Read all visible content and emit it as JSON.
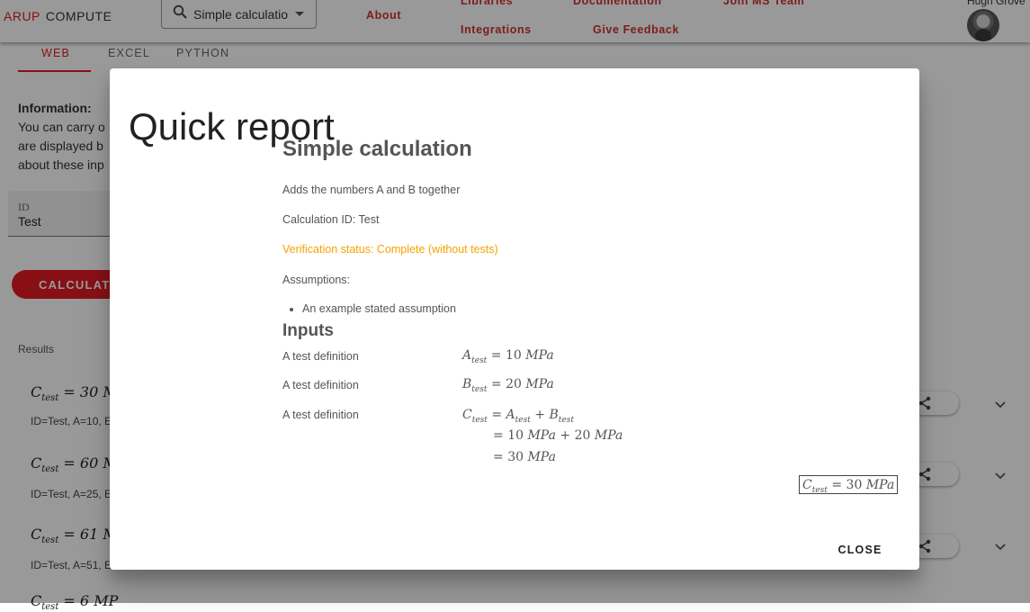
{
  "header": {
    "brand_arup": "ARUP",
    "brand_compute": "COMPUTE",
    "calc_select_value": "Simple calculation",
    "nav": {
      "about": "About",
      "libraries": "Libraries",
      "documentation": "Documentation",
      "join_team": "Join MS Team",
      "integrations": "Integrations",
      "feedback": "Give Feedback"
    },
    "user_name": "Hugh Grove"
  },
  "tabs": {
    "web": "WEB",
    "excel": "EXCEL",
    "python": "PYTHON"
  },
  "info": {
    "heading": "Information:",
    "line1": "You can carry o",
    "line2": "are displayed b",
    "line3": "about these inp"
  },
  "id_field": {
    "label": "ID",
    "value": "Test"
  },
  "calculate_label": "CALCULATE",
  "results_label": "Results",
  "results": [
    {
      "value": "30 M",
      "sub": "ID=Test, A=10, E"
    },
    {
      "value": "60 M",
      "sub": "ID=Test, A=25, E"
    },
    {
      "value": "61 M",
      "sub": "ID=Test, A=51, E"
    },
    {
      "value": "6 MP"
    }
  ],
  "dialog": {
    "title": "Quick report",
    "calc_title": "Simple calculation",
    "description": "Adds the numbers A and B together",
    "calc_id": "Calculation ID: Test",
    "verification": "Verification status: Complete (without tests)",
    "assumptions_label": "Assumptions:",
    "assumptions": [
      "An example stated assumption"
    ],
    "inputs_heading": "Inputs",
    "inputs": [
      {
        "definition": "A test definition"
      },
      {
        "definition": "A test definition"
      },
      {
        "definition": "A test definition"
      }
    ],
    "a_value": "10",
    "b_value": "20",
    "c_value": "30",
    "unit": "MPa",
    "close_label": "CLOSE"
  },
  "colors": {
    "brand_red": "#e31b23",
    "status_orange": "#f5a300"
  }
}
